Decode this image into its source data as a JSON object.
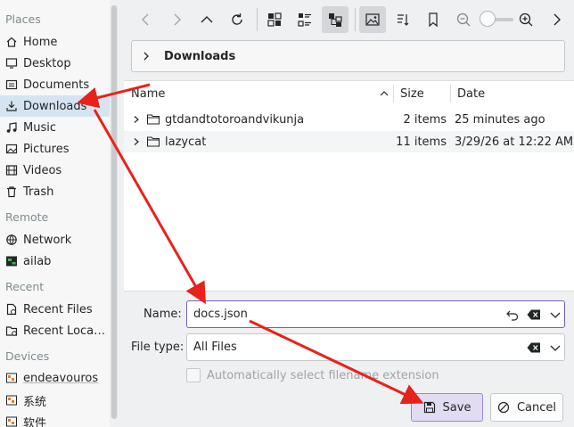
{
  "sidebar": {
    "sections": [
      {
        "header": "Places",
        "items": [
          {
            "label": "Home",
            "icon": "home-icon"
          },
          {
            "label": "Desktop",
            "icon": "desktop-icon"
          },
          {
            "label": "Documents",
            "icon": "documents-icon"
          },
          {
            "label": "Downloads",
            "icon": "downloads-icon",
            "active": true
          },
          {
            "label": "Music",
            "icon": "music-icon"
          },
          {
            "label": "Pictures",
            "icon": "pictures-icon"
          },
          {
            "label": "Videos",
            "icon": "videos-icon"
          },
          {
            "label": "Trash",
            "icon": "trash-icon"
          }
        ]
      },
      {
        "header": "Remote",
        "items": [
          {
            "label": "Network",
            "icon": "network-icon"
          },
          {
            "label": "ailab",
            "icon": "remote-folder-icon"
          }
        ]
      },
      {
        "header": "Recent",
        "items": [
          {
            "label": "Recent Files",
            "icon": "recent-files-icon"
          },
          {
            "label": "Recent Loca…",
            "icon": "recent-locations-icon"
          }
        ]
      },
      {
        "header": "Devices",
        "items": [
          {
            "label": "endeavouros",
            "icon": "drive-icon"
          },
          {
            "label": "系统",
            "icon": "drive-icon"
          },
          {
            "label": "软件",
            "icon": "drive-icon"
          }
        ]
      }
    ]
  },
  "toolbar": {
    "buttons": [
      "back-icon",
      "forward-icon",
      "up-icon",
      "reload-icon",
      "icons-view-icon",
      "compact-view-icon",
      "tree-view-icon",
      "preview-icon",
      "sort-icon",
      "bookmark-icon",
      "zoom-out-icon",
      "zoom-in-icon",
      "more-icon"
    ],
    "zoom_level": 0
  },
  "breadcrumb": {
    "current": "Downloads"
  },
  "filelist": {
    "columns": {
      "name": "Name",
      "size": "Size",
      "date": "Date"
    },
    "sort": {
      "column": "Name",
      "direction": "ascending"
    },
    "rows": [
      {
        "name": "gtdandtotoroandvikunja",
        "size": "2 items",
        "date": "25 minutes ago"
      },
      {
        "name": "lazycat",
        "size": "11 items",
        "date": "3/29/26 at 12:22 AM"
      }
    ]
  },
  "form": {
    "name_label": "Name:",
    "name_value": "docs.json",
    "filetype_label": "File type:",
    "filetype_value": "All Files",
    "auto_ext_label": "Automatically select filename extension",
    "auto_ext_checked": false,
    "save_label": "Save",
    "cancel_label": "Cancel"
  },
  "colors": {
    "accent": "#7b5cc4",
    "selection": "#d6e4f2",
    "annotation_arrow": "#e8221a"
  }
}
